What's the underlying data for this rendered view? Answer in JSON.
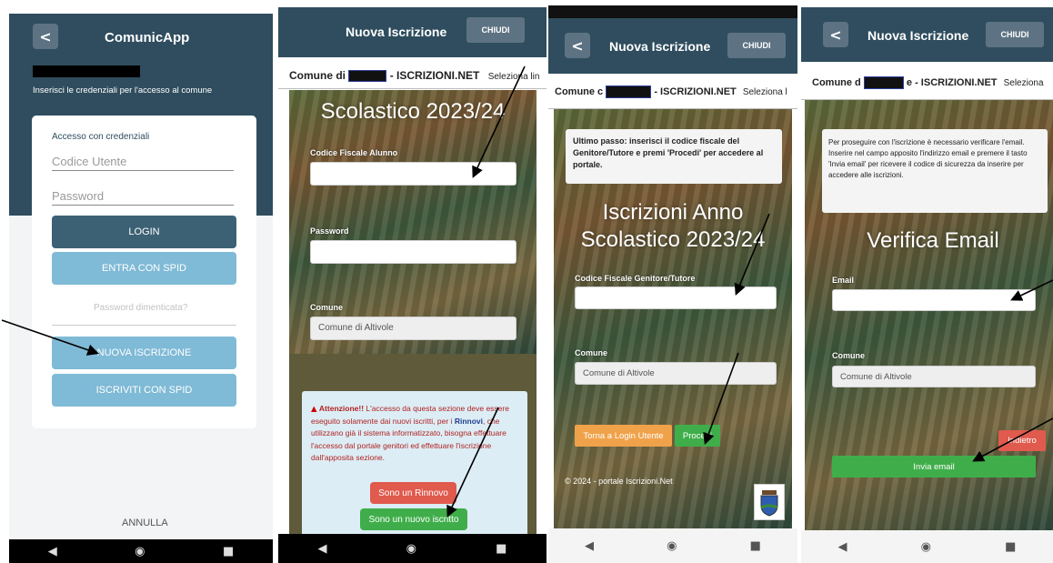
{
  "screen1": {
    "app_title": "ComunicApp",
    "instructions": "Inserisci le credenziali per l'accesso al comune",
    "card_heading": "Accesso con credenziali",
    "user_placeholder": "Codice Utente",
    "password_placeholder": "Password",
    "login_label": "LOGIN",
    "spid_label": "ENTRA CON SPID",
    "forgot_label": "Password dimenticata?",
    "new_reg_label": "NUOVA ISCRIZIONE",
    "spid_reg_label": "ISCRIVITI CON SPID",
    "cancel_label": "ANNULLA"
  },
  "screen2": {
    "header_title": "Nuova Iscrizione",
    "close_label": "CHIUDI",
    "strip_prefix": "Comune di",
    "strip_suffix": "- ISCRIZIONI.NET",
    "strip_select": "Seleziona lin",
    "big_heading": "Scolastico 2023/24",
    "cf_label": "Codice Fiscale Alunno",
    "password_label": "Password",
    "comune_label": "Comune",
    "comune_value": "Comune di Altivole",
    "warn_title": "Attenzione!!",
    "warn_part1": " L'accesso da questa sezione deve essere eseguito solamente dai nuovi iscritti, per i ",
    "warn_rinnovi": "Rinnovi",
    "warn_part2": ", che utilizzano già il sistema informatizzato, bisogna effettuare l'accesso dal portale genitori ed effettuare l'iscrizione dall'apposita sezione.",
    "renew_label": "Sono un Rinnovo",
    "new_label": "Sono un nuovo iscritto"
  },
  "screen3": {
    "header_title": "Nuova Iscrizione",
    "close_label": "CHIUDI",
    "strip_prefix": "Comune c",
    "strip_suffix": "- ISCRIZIONI.NET",
    "strip_select": "Seleziona l",
    "info_text": "Ultimo passo: inserisci il codice fiscale del Genitore/Tutore e premi 'Procedi' per accedere al portale.",
    "big_line1": "Iscrizioni Anno",
    "big_line2": "Scolastico 2023/24",
    "cf_label": "Codice Fiscale Genitore/Tutore",
    "comune_label": "Comune",
    "comune_value": "Comune di Altivole",
    "back_login_label": "Torna a Login Utente",
    "proceed_label": "Procedi",
    "footer": "© 2024 - portale Iscrizioni.Net"
  },
  "screen4": {
    "header_title": "Nuova Iscrizione",
    "close_label": "CHIUDI",
    "strip_prefix": "Comune d",
    "strip_suffix": "e - ISCRIZIONI.NET",
    "strip_select": "Seleziona",
    "info_text": "Per proseguire con l'iscrizione è necessario verificare l'email. Inserire nel campo apposito l'indirizzo email e premere il tasto 'Invia email' per ricevere il codice di sicurezza da inserire per accedere alle iscrizioni.",
    "big_heading": "Verifica Email",
    "email_label": "Email",
    "comune_label": "Comune",
    "comune_value": "Comune di Altivole",
    "back_label": "Indietro",
    "send_label": "Invia email"
  },
  "nav": {
    "back_glyph": "◀",
    "home_glyph": "◉",
    "recent_glyph": "■"
  },
  "colors": {
    "teal_dark": "#2f4d5e",
    "button_dark": "#3c6174",
    "button_light": "#7fbad6",
    "green": "#3fae4a",
    "orange": "#f0a24a",
    "red": "#e05a4d"
  }
}
